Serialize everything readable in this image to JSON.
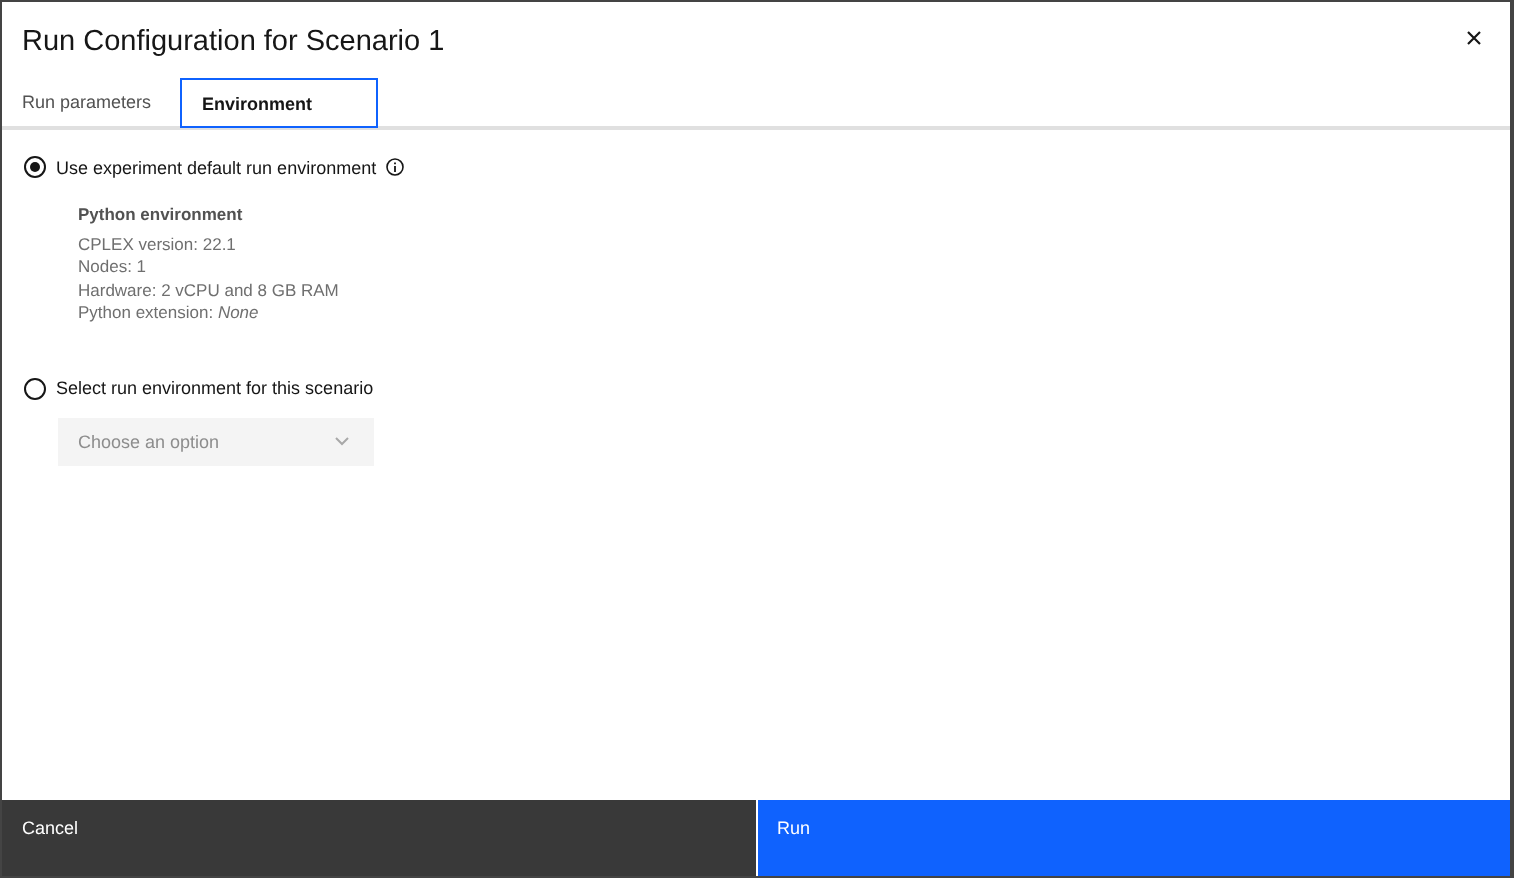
{
  "window": {
    "title": "Run Configuration for Scenario 1"
  },
  "tabs": [
    {
      "label": "Run parameters",
      "selected": false
    },
    {
      "label": "Environment",
      "selected": true
    }
  ],
  "options": [
    {
      "label": "Use experiment default run environment",
      "selected": true,
      "info": true,
      "details": {
        "heading": "Python environment",
        "lines": [
          "CPLEX version: 22.1",
          "Nodes: 1",
          "Hardware: 2 vCPU and 8 GB RAM",
          "Python extension: *None*"
        ]
      }
    },
    {
      "label": "Select run environment for this scenario",
      "selected": false,
      "info": false,
      "dropdown": {
        "placeholder": "Choose an option",
        "disabled": true
      }
    }
  ],
  "buttons": [
    {
      "label": "Cancel",
      "kind": "secondary"
    },
    {
      "label": "Run",
      "kind": "primary"
    }
  ]
}
